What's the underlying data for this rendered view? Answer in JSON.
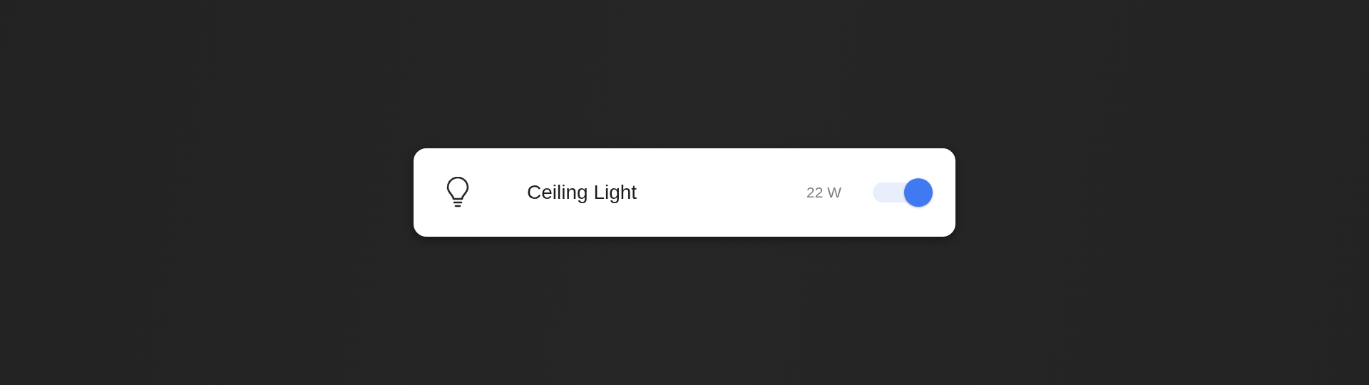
{
  "device": {
    "name": "Ceiling Light",
    "power": "22 W",
    "on": true
  }
}
